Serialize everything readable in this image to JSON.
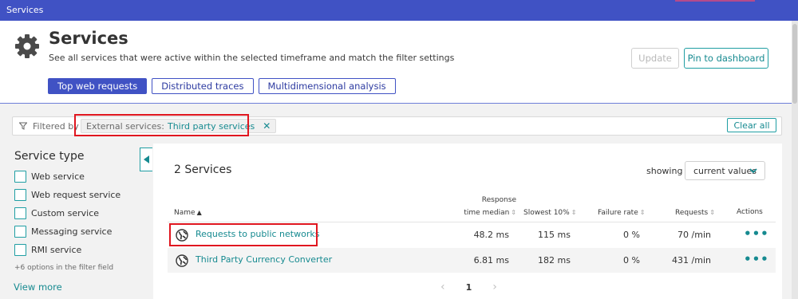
{
  "topbar": {
    "title": "Services"
  },
  "header": {
    "icon": "gear-icon",
    "title": "Services",
    "subtitle": "See all services that were active within the selected timeframe and match the filter settings",
    "update_label": "Update",
    "pin_label": "Pin to dashboard",
    "tabs": [
      {
        "label": "Top web requests",
        "active": true
      },
      {
        "label": "Distributed traces",
        "active": false
      },
      {
        "label": "Multidimensional analysis",
        "active": false
      }
    ]
  },
  "filter": {
    "label": "Filtered by",
    "chip_key": "External services:",
    "chip_value": "Third party services",
    "chip_remove": "✕",
    "clear_all": "Clear all"
  },
  "sidebar": {
    "title": "Service type",
    "options": [
      {
        "label": "Web service"
      },
      {
        "label": "Web request service"
      },
      {
        "label": "Custom service"
      },
      {
        "label": "Messaging service"
      },
      {
        "label": "RMI service"
      }
    ],
    "more_options": "+6 options in the filter field",
    "view_more": "View more"
  },
  "main": {
    "count": "2 Services",
    "showing_label": "showing",
    "showing_value": "current values",
    "columns": {
      "name": "Name",
      "response_l1": "Response",
      "response_l2": "time median",
      "slowest": "Slowest 10%",
      "failure": "Failure rate",
      "requests": "Requests",
      "actions": "Actions"
    },
    "rows": [
      {
        "name": "Requests to public networks",
        "response": "48.2 ms",
        "slowest": "115 ms",
        "failure": "0 %",
        "requests": "70 /min",
        "actions": "•••"
      },
      {
        "name": "Third Party Currency Converter",
        "response": "6.81 ms",
        "slowest": "182 ms",
        "failure": "0 %",
        "requests": "431 /min",
        "actions": "•••"
      }
    ],
    "pager": {
      "prev": "‹",
      "page": "1",
      "next": "›"
    }
  },
  "colors": {
    "brand": "#4052c4",
    "accent_teal": "#168a90",
    "highlight": "#e0161f"
  }
}
